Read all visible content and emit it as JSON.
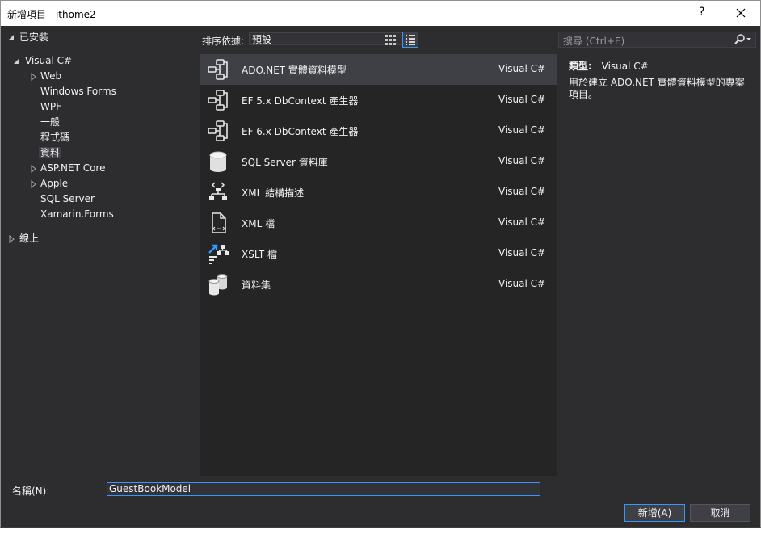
{
  "window": {
    "title": "新增項目 - ithome2",
    "help_label": "?"
  },
  "left_tree": {
    "installed": "已安裝",
    "visual_csharp": "Visual C#",
    "children": [
      "Web",
      "Windows Forms",
      "WPF",
      "一般",
      "程式碼",
      "資料",
      "ASP.NET Core",
      "Apple",
      "SQL Server",
      "Xamarin.Forms"
    ],
    "selected": "資料",
    "online": "線上"
  },
  "toolbar": {
    "sort_label": "排序依據:",
    "sort_value": "預設"
  },
  "search": {
    "placeholder": "搜尋 (Ctrl+E)"
  },
  "templates": [
    {
      "name": "ADO.NET 實體資料模型",
      "lang": "Visual C#",
      "icon": "entity-model-icon"
    },
    {
      "name": "EF 5.x DbContext 產生器",
      "lang": "Visual C#",
      "icon": "entity-model-icon"
    },
    {
      "name": "EF 6.x DbContext 產生器",
      "lang": "Visual C#",
      "icon": "entity-model-icon"
    },
    {
      "name": "SQL Server 資料庫",
      "lang": "Visual C#",
      "icon": "database-icon"
    },
    {
      "name": "XML 結構描述",
      "lang": "Visual C#",
      "icon": "xml-schema-icon"
    },
    {
      "name": "XML 檔",
      "lang": "Visual C#",
      "icon": "xml-file-icon"
    },
    {
      "name": "XSLT 檔",
      "lang": "Visual C#",
      "icon": "xslt-file-icon"
    },
    {
      "name": "資料集",
      "lang": "Visual C#",
      "icon": "dataset-icon"
    }
  ],
  "details": {
    "type_label": "類型:",
    "type_value": "Visual C#",
    "description": "用於建立 ADO.NET 實體資料模型的專案項目。"
  },
  "footer": {
    "name_label": "名稱(N):",
    "name_value": "GuestBookModel",
    "add_button": "新增(A)",
    "cancel_button": "取消"
  },
  "colors": {
    "background": "#2d2d30",
    "panel": "#252526",
    "selected": "#3f3f46",
    "accent": "#3399ff"
  }
}
